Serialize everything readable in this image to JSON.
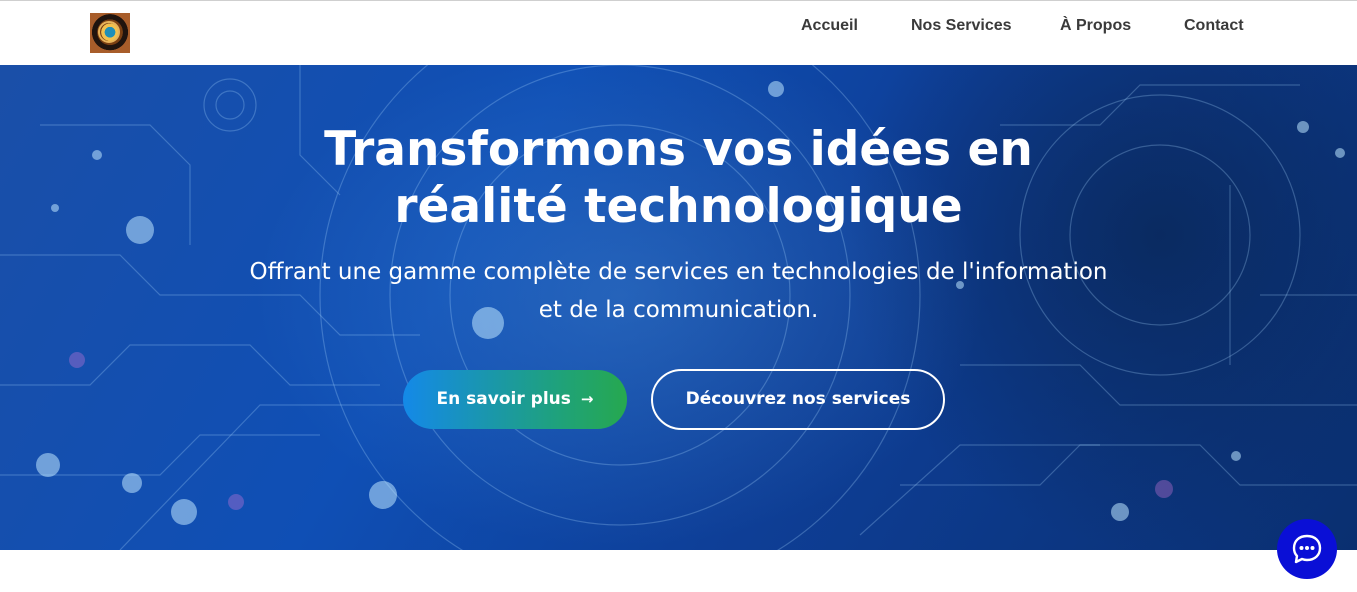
{
  "nav": {
    "logo_icon": "robot-logo-icon",
    "links": [
      "Accueil",
      "Nos Services",
      "À Propos",
      "Contact"
    ]
  },
  "hero": {
    "title_line1": "Transformons vos idées en",
    "title_line2": "réalité technologique",
    "subtitle_line1": "Offrant une gamme complète de services en technologies de l'information",
    "subtitle_line2": "et de la communication.",
    "primary_button": "En savoir plus",
    "primary_button_icon": "arrow-right-icon",
    "secondary_button": "Découvrez nos services"
  },
  "chat": {
    "icon": "chat-bubble-icon"
  },
  "colors": {
    "hero_blue": "#0f4fb5",
    "button_gradient_start": "#1489e8",
    "button_gradient_end": "#26a84f",
    "chat_button": "#0a0fd6",
    "nav_text": "#3a3a3a"
  }
}
